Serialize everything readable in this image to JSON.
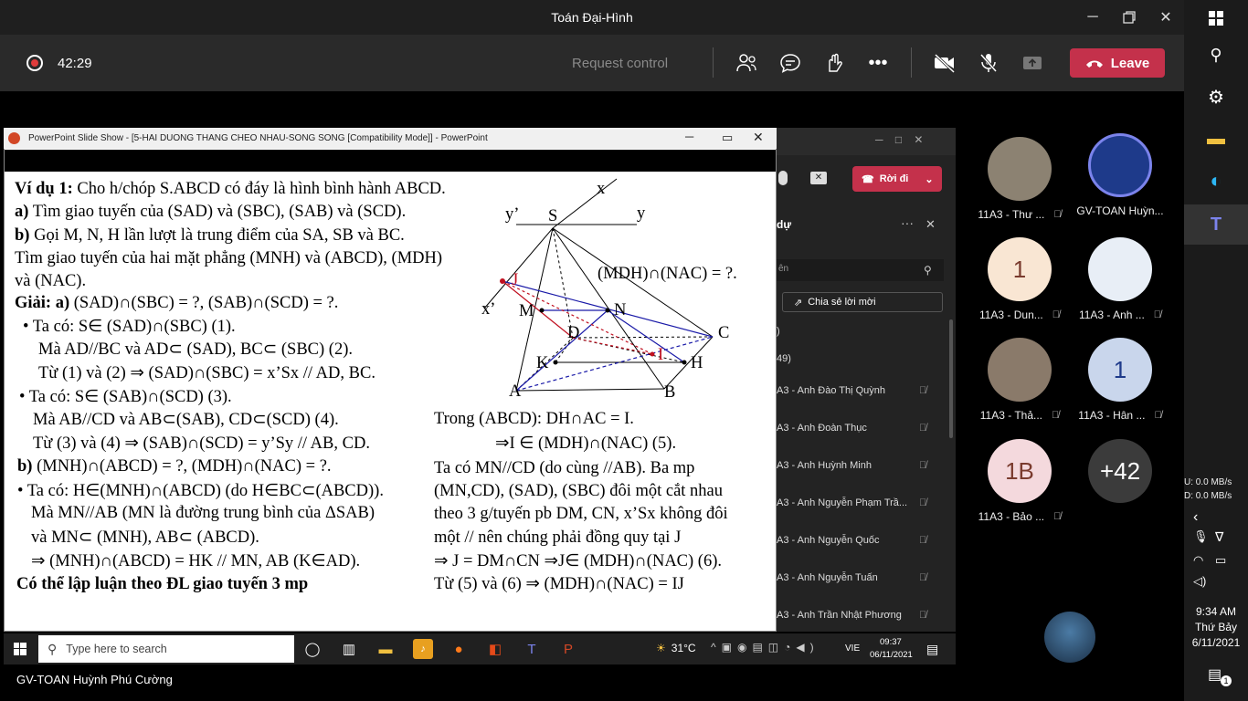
{
  "window": {
    "title": "Toán Đại-Hình"
  },
  "call": {
    "timer": "42:29",
    "request_control": "Request control",
    "leave_label": "Leave"
  },
  "ppt": {
    "title": "PowerPoint Slide Show - [5-HAI DUONG THANG CHEO NHAU-SONG SONG [Compatibility Mode]] - PowerPoint",
    "left_lines": [
      "Ví dụ 1: Cho h/chóp S.ABCD có đáy là hình bình hành ABCD.",
      "a) Tìm giao tuyến của (SAD) và (SBC), (SAB) và (SCD).",
      "b) Gọi M, N, H lần lượt là trung điểm của SA, SB và BC.",
      "Tìm giao tuyến của hai mặt phẳng (MNH) và (ABCD), (MDH)",
      "và (NAC).",
      "Giải:  a) (SAD)∩(SBC) = ?, (SAB)∩(SCD) = ?.",
      "• Ta có: S∈ (SAD)∩(SBC) (1).",
      "Mà AD//BC và AD⊂ (SAD), BC⊂ (SBC) (2).",
      "Từ (1) và (2) ⇒ (SAD)∩(SBC) = x’Sx // AD, BC.",
      "• Ta có: S∈ (SAB)∩(SCD) (3).",
      "Mà AB//CD và AB⊂(SAB), CD⊂(SCD) (4).",
      "Từ (3) và (4) ⇒ (SAB)∩(SCD) = y’Sy // AB, CD.",
      "b) (MNH)∩(ABCD) = ?, (MDH)∩(NAC) = ?.",
      "• Ta có: H∈(MNH)∩(ABCD) (do H∈BC⊂(ABCD)).",
      "Mà MN//AB (MN là đường trung bình của ΔSAB)",
      "và MN⊂ (MNH), AB⊂ (ABCD).",
      "⇒ (MNH)∩(ABCD) = HK // MN, AB (K∈AD).",
      "Có thể lập luận theo ĐL giao tuyến 3 mp"
    ],
    "right_lines": [
      "Trong (ABCD): DH∩AC = I.",
      "⇒I ∈ (MDH)∩(NAC)  (5).",
      "Ta có MN//CD (do cùng //AB). Ba mp",
      "(MN,CD), (SAD), (SBC) đôi một cắt nhau",
      "theo 3 g/tuyến pb DM, CN, x’Sx không đôi",
      "một // nên chúng phải đồng quy tại J",
      "⇒ J = DM∩CN ⇒J∈ (MDH)∩(NAC) (6).",
      "Từ (5) và (6) ⇒ (MDH)∩(NAC) = IJ"
    ],
    "question": "(MDH)∩(NAC) = ?.",
    "labels": {
      "x": "x",
      "y": "y",
      "y2": "y’",
      "x2": "x’",
      "S": "S",
      "J": "J",
      "M": "M",
      "N": "N",
      "D": "D",
      "C": "C",
      "I": "I",
      "K": "K",
      "H": "H",
      "A": "A",
      "B": "B"
    }
  },
  "ghost": {
    "leave": "Rời đi",
    "panel_title": "dự",
    "search": "ên",
    "invite": "Chia sẻ lời mời",
    "count_a": ")",
    "count_b": "49)",
    "people": [
      "A3 - Anh Đào Thị Quỳnh",
      "A3 - Anh Đoàn Thục",
      "A3 - Anh Huỳnh Minh",
      "A3 - Anh Nguyễn Phạm Trầ...",
      "A3 - Anh Nguyễn Quốc",
      "A3 - Anh Nguyễn Tuấn",
      "A3 - Anh Trần Nhật Phương"
    ]
  },
  "taskbar": {
    "search_placeholder": "Type here to search",
    "weather": "31°C",
    "lang": "VIE",
    "time": "09:37",
    "date": "06/11/2021"
  },
  "presenter": "GV-TOAN Huỳnh Phú Cường",
  "participants": [
    {
      "name": "11A3 - Thư ...",
      "initials": "",
      "color": "#8c8272",
      "muted": true
    },
    {
      "name": "GV-TOAN Huỳn...",
      "initials": "",
      "color": "#1e3a8a",
      "muted": false
    },
    {
      "name": "11A3 - Dun...",
      "initials": "1",
      "color": "#f9e6d3",
      "muted": true
    },
    {
      "name": "11A3 - Anh ...",
      "initials": "",
      "color": "#e8eef6",
      "muted": true
    },
    {
      "name": "11A3 - Thả...",
      "initials": "",
      "color": "#8a7a6a",
      "muted": true
    },
    {
      "name": "11A3 - Hân ...",
      "initials": "1",
      "color": "#c9d6ec",
      "muted": true
    },
    {
      "name": "11A3 - Bảo ...",
      "initials": "1B",
      "color": "#f4d9dd",
      "muted": true
    },
    {
      "name": "",
      "initials": "+42",
      "color": "#3b3b3b",
      "muted": false
    }
  ],
  "system": {
    "net_up": "U:    0.0 MB/s",
    "net_down": "D:    0.0 MB/s",
    "clock": "9:34 AM",
    "day": "Thứ Bảy",
    "date": "6/11/2021",
    "notif": "1"
  }
}
